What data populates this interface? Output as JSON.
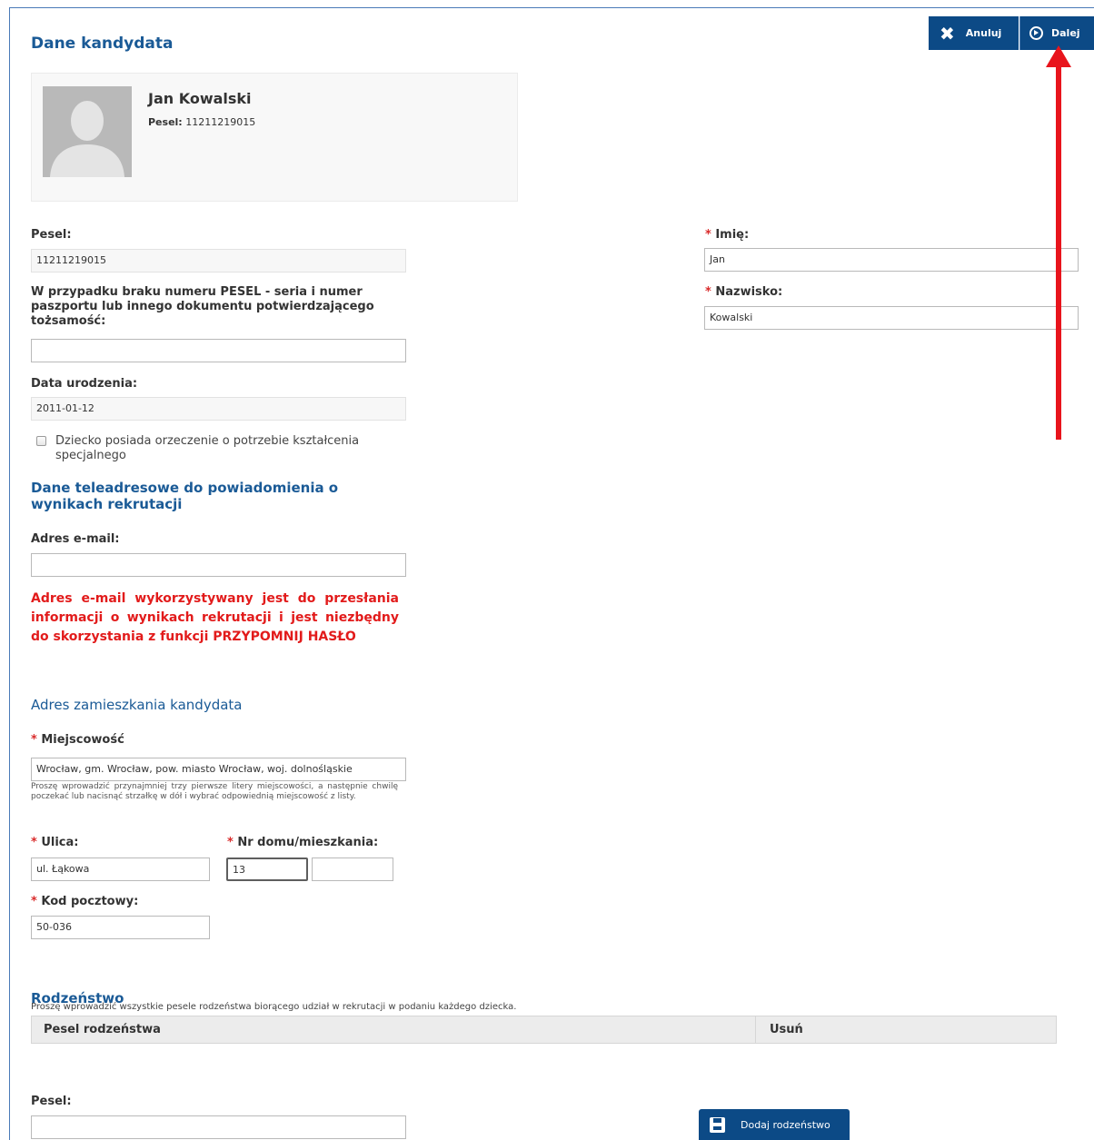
{
  "header": {
    "title": "Dane kandydata",
    "cancel_label": "Anuluj",
    "next_label": "Dalej"
  },
  "candidate": {
    "name": "Jan Kowalski",
    "pesel_label": "Pesel:",
    "pesel_value": "11211219015"
  },
  "form": {
    "pesel_label": "Pesel:",
    "pesel_value": "11211219015",
    "passport_label": "W przypadku braku numeru PESEL - seria i numer paszportu lub innego dokumentu potwierdzającego tożsamość:",
    "passport_value": "",
    "birthdate_label": "Data urodzenia:",
    "birthdate_value": "2011-01-12",
    "special_needs_label": "Dziecko posiada orzeczenie o potrzebie kształcenia specjalnego",
    "first_name_label": "Imię:",
    "first_name_value": "Jan",
    "last_name_label": "Nazwisko:",
    "last_name_value": "Kowalski",
    "required_mark": "*"
  },
  "contact": {
    "title": "Dane teleadresowe do powiadomienia o wynikach rekrutacji",
    "email_label": "Adres e-mail:",
    "email_value": "",
    "warning": "Adres e-mail wykorzystywany jest do przesłania informacji o wynikach rekrutacji i jest niezbędny do skorzystania z funkcji PRZYPOMNIJ HASŁO"
  },
  "address": {
    "title": "Adres zamieszkania kandydata",
    "city_label": "Miejscowość",
    "city_value": "Wrocław, gm. Wrocław, pow. miasto Wrocław, woj. dolnośląskie",
    "city_hint": "Proszę wprowadzić przynajmniej trzy pierwsze litery miejscowości, a następnie chwilę poczekać lub nacisnąć strzałkę w dół i wybrać odpowiednią miejscowość z listy.",
    "street_label": "Ulica:",
    "street_value": "ul. Łąkowa",
    "house_label": "Nr domu/mieszkania:",
    "house_value": "13",
    "flat_value": "",
    "postal_label": "Kod pocztowy:",
    "postal_value": "50-036"
  },
  "siblings": {
    "title": "Rodzeństwo",
    "instruction": "Proszę wprowadzić wszystkie pesele rodzeństwa biorącego udział w rekrutacji w podaniu każdego dziecka.",
    "col_pesel": "Pesel rodzeństwa",
    "col_remove": "Usuń",
    "pesel_label": "Pesel:",
    "pesel_value": "",
    "add_label": "Dodaj rodzeństwo"
  },
  "colors": {
    "heading": "#1a5a96",
    "button": "#0c4a86",
    "warning": "#e21b1b",
    "arrow": "#e8141c"
  },
  "icons": [
    "close-icon",
    "next-circle-icon",
    "avatar-placeholder",
    "save-icon",
    "arrow-up-annotation"
  ]
}
